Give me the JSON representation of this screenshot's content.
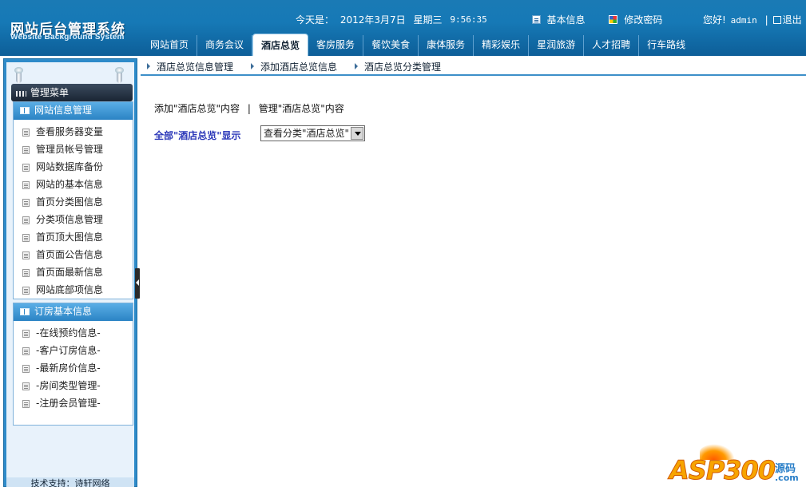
{
  "header": {
    "title": "网站后台管理系统",
    "subtitle": "Website Background System",
    "today_label": "今天是：",
    "date": "2012年3月7日",
    "weekday": "星期三",
    "time": "9:56:35",
    "basic_info": "基本信息",
    "change_password": "修改密码",
    "greeting": "您好",
    "greeting_mark": "!",
    "username": "admin",
    "separator": "|",
    "logout": "退出"
  },
  "nav": {
    "tabs": [
      {
        "label": "网站首页"
      },
      {
        "label": "商务会议"
      },
      {
        "label": "酒店总览"
      },
      {
        "label": "客房服务"
      },
      {
        "label": "餐饮美食"
      },
      {
        "label": "康体服务"
      },
      {
        "label": "精彩娱乐"
      },
      {
        "label": "星润旅游"
      },
      {
        "label": "人才招聘"
      },
      {
        "label": "行车路线"
      }
    ],
    "active_index": 2
  },
  "sidebar": {
    "menu_title": "管理菜单",
    "groups": [
      {
        "title": "网站信息管理",
        "items": [
          {
            "label": "查看服务器变量"
          },
          {
            "label": "管理员帐号管理"
          },
          {
            "label": "网站数据库备份"
          },
          {
            "label": "网站的基本信息"
          },
          {
            "label": "首页分类图信息"
          },
          {
            "label": "分类项信息管理"
          },
          {
            "label": "首页顶大图信息"
          },
          {
            "label": "首页面公告信息"
          },
          {
            "label": "首页面最新信息"
          },
          {
            "label": "网站底部项信息"
          }
        ]
      },
      {
        "title": "订房基本信息",
        "items": [
          {
            "label": "-在线预约信息-"
          },
          {
            "label": "-客户订房信息-"
          },
          {
            "label": "-最新房价信息-"
          },
          {
            "label": "-房间类型管理-"
          },
          {
            "label": "-注册会员管理-"
          }
        ]
      }
    ],
    "tech_support": "技术支持：诗轩网络"
  },
  "breadcrumb": {
    "items": [
      {
        "label": "酒店总览信息管理"
      },
      {
        "label": "添加酒店总览信息"
      },
      {
        "label": "酒店总览分类管理"
      }
    ]
  },
  "content": {
    "add_link": "添加\"酒店总览\"内容",
    "divider": "|",
    "manage_link": "管理\"酒店总览\"内容",
    "all_label": "全部\"酒店总览\"显示",
    "category_select": "查看分类\"酒店总览\""
  },
  "watermark": {
    "text": "ASP300",
    "sub": "源码",
    "domain": ".com"
  },
  "colors": {
    "header_blue": "#1679b6",
    "sidebar_blue": "#2e8bc9",
    "label_blue": "#2a36b8",
    "watermark_orange": "#f7a400"
  }
}
